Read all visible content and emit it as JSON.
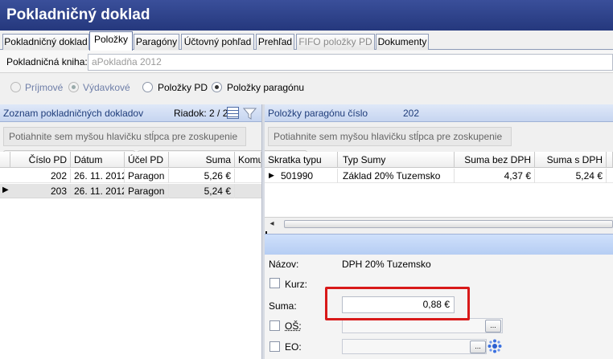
{
  "title": "Pokladničný doklad",
  "tabs": [
    "Pokladničný doklad",
    "Položky",
    "Paragóny",
    "Účtovný pohľad",
    "Prehľad",
    "FIFO položky PD",
    "Dokumenty"
  ],
  "kniha": {
    "label": "Pokladničná kniha:",
    "value": "aPokladňa 2012"
  },
  "radios": {
    "prijmove": "Príjmové",
    "vydavkove": "Výdavkové",
    "polozky_pd": "Položky PD",
    "polozky_paragonu": "Položky paragónu"
  },
  "left_panel": {
    "title": "Zoznam pokladničných dokladov",
    "riadok": "Riadok: 2 / 2",
    "group_hint": "Potiahnite sem myšou hlavičku stĺpca pre zoskupenie",
    "columns": [
      "Číslo PD",
      "Dátum",
      "Účel PD",
      "Suma",
      "Komu"
    ],
    "rows": [
      [
        "202",
        "26. 11. 2012",
        "Paragon",
        "5,26 €"
      ],
      [
        "203",
        "26. 11. 2012",
        "Paragon",
        "5,24 €"
      ]
    ]
  },
  "right_panel": {
    "title": "Položky paragónu číslo",
    "number": "202",
    "group_hint": "Potiahnite sem myšou hlavičku stĺpca pre zoskupenie",
    "columns": [
      "Skratka typu",
      "Typ Sumy",
      "Suma bez DPH",
      "Suma s DPH"
    ],
    "rows": [
      [
        "501990",
        "Základ 20% Tuzemsko",
        "4,37 €",
        "5,24 €"
      ]
    ],
    "scroll_left": "◂"
  },
  "detail": {
    "nazov_label": "Názov:",
    "nazov_value": "DPH 20% Tuzemsko",
    "kurz_label": "Kurz:",
    "suma_label": "Suma:",
    "suma_value": "0,88 €",
    "os_label": "OŠ:",
    "eo_label": "EO:",
    "ellipsis": "..."
  }
}
